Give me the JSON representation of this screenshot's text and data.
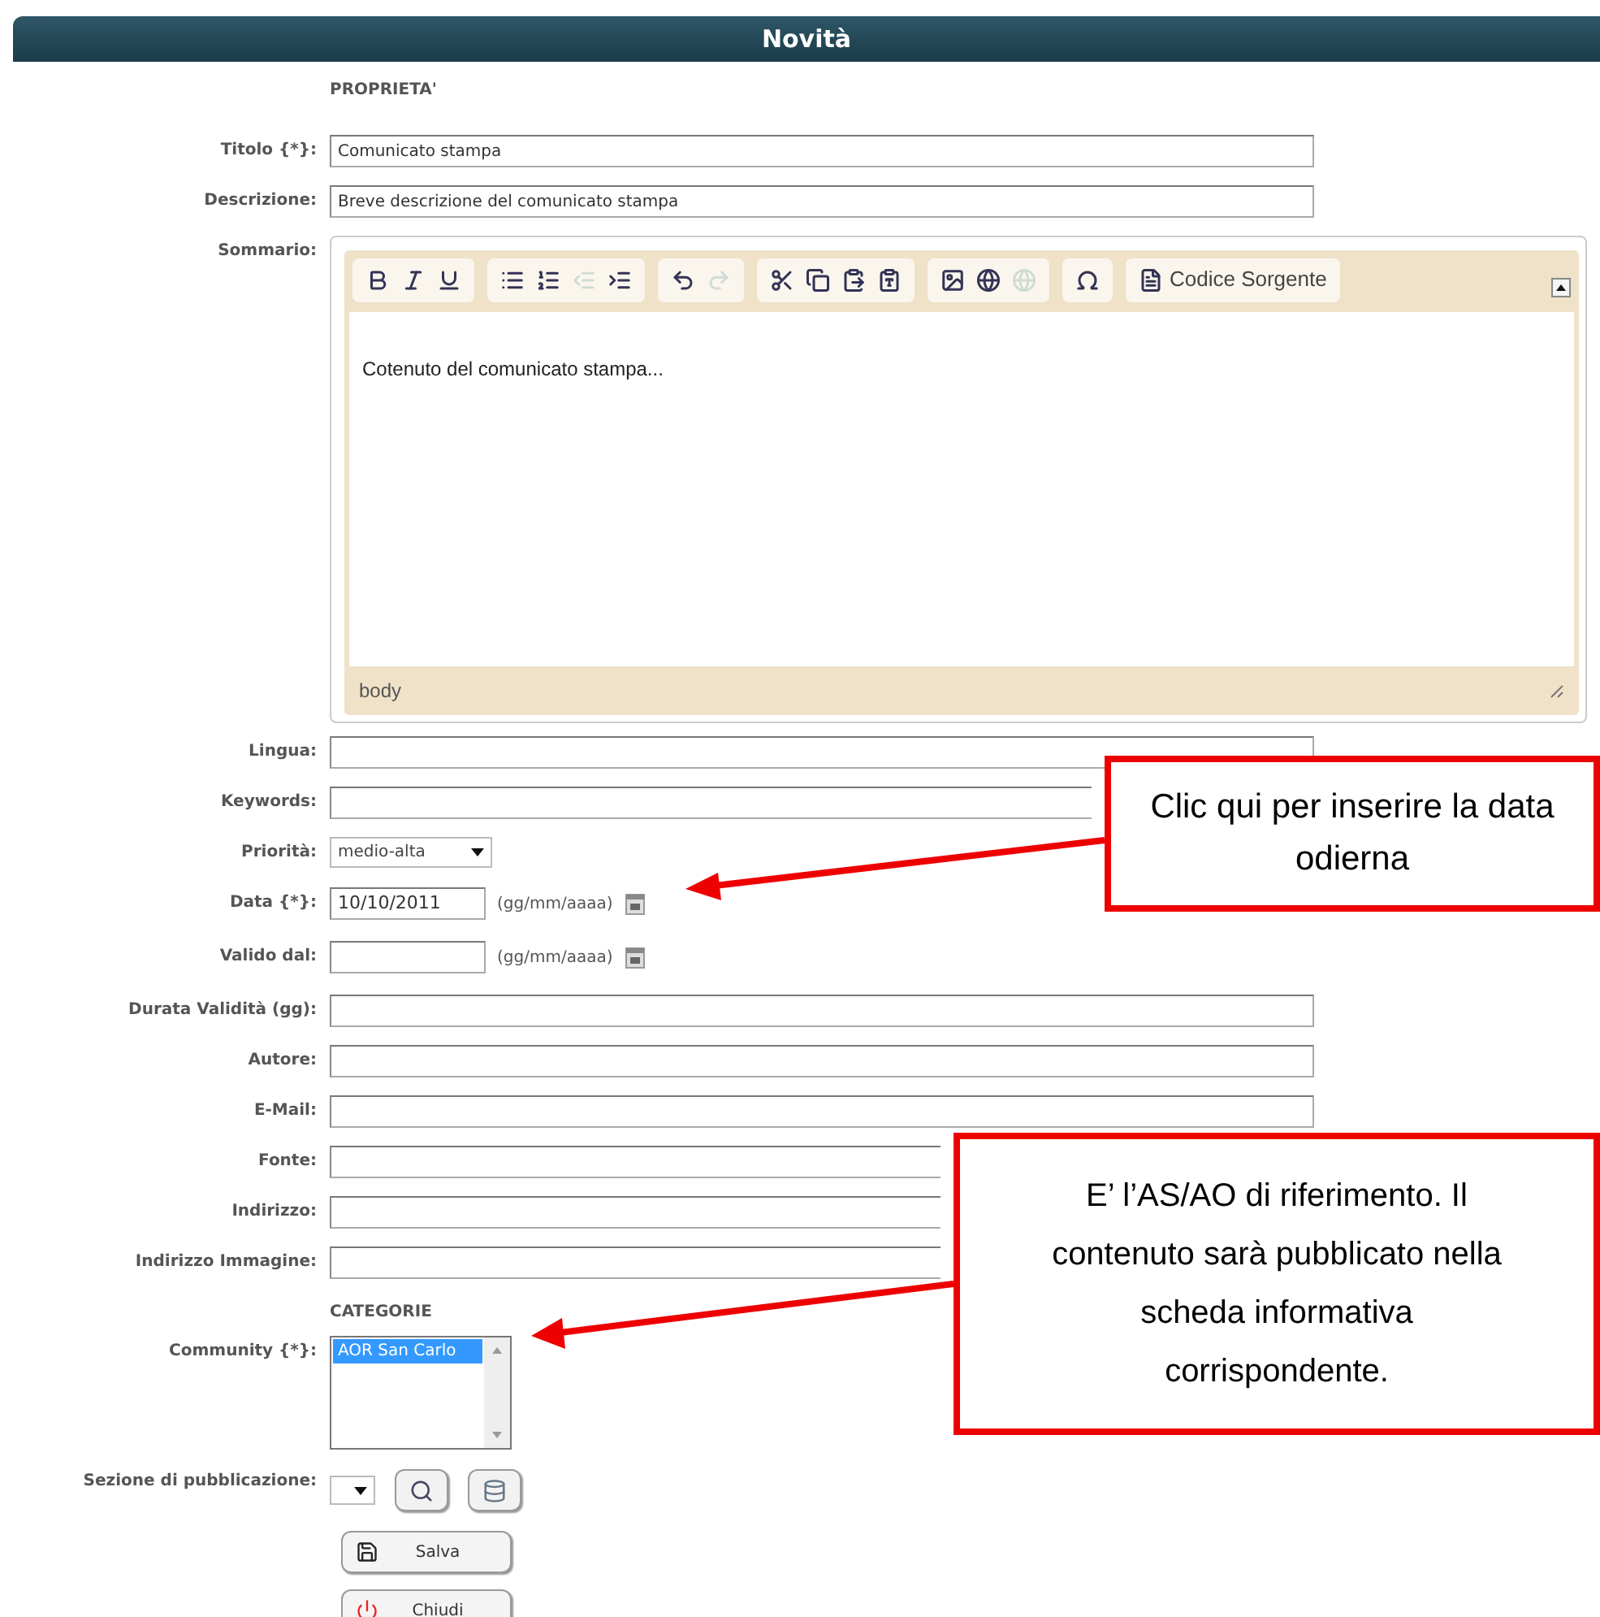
{
  "header": {
    "title": "Novità"
  },
  "section": "PROPRIETA'",
  "fields": [
    {
      "kind": "text",
      "label": "Titolo {*}:",
      "value": "Comunicato stampa"
    },
    {
      "kind": "text",
      "label": "Descrizione:",
      "value": "Breve descrizione del comunicato stampa"
    },
    {
      "kind": "editor",
      "label": "Sommario:",
      "content": "Cotenuto del comunicato stampa...",
      "status": "body",
      "toolbar": [
        [
          {
            "kind": "bold",
            "disabled": false
          },
          {
            "kind": "italic",
            "disabled": false
          },
          {
            "kind": "underline",
            "disabled": false
          }
        ],
        [
          {
            "kind": "bullets",
            "disabled": false
          },
          {
            "kind": "numbers",
            "disabled": false
          },
          {
            "kind": "outdent",
            "disabled": true
          },
          {
            "kind": "indent",
            "disabled": false
          }
        ],
        [
          {
            "kind": "undo",
            "disabled": false
          },
          {
            "kind": "redo",
            "disabled": true
          }
        ],
        [
          {
            "kind": "cut",
            "disabled": false
          },
          {
            "kind": "copy",
            "disabled": false
          },
          {
            "kind": "paste",
            "disabled": false
          },
          {
            "kind": "pasteword",
            "disabled": false
          }
        ],
        [
          {
            "kind": "image",
            "disabled": false
          },
          {
            "kind": "link",
            "disabled": false
          },
          {
            "kind": "unlink",
            "disabled": true
          }
        ],
        [
          {
            "kind": "special",
            "disabled": false
          }
        ],
        [
          {
            "kind": "source",
            "disabled": false,
            "label": "Codice Sorgente"
          }
        ]
      ]
    },
    {
      "kind": "text",
      "label": "Lingua:"
    },
    {
      "kind": "text",
      "label": "Keywords:"
    },
    {
      "kind": "select",
      "label": "Priorità:",
      "value": "medio-alta"
    },
    {
      "kind": "date",
      "label": "Data {*}:",
      "value": "10/10/2011",
      "hint": "(gg/mm/aaaa)"
    },
    {
      "kind": "date",
      "label": "Valido dal:",
      "hint": "(gg/mm/aaaa)"
    },
    {
      "kind": "text",
      "label": "Durata Validità (gg):"
    },
    {
      "kind": "text",
      "label": "Autore:"
    },
    {
      "kind": "text",
      "label": "E-Mail:"
    },
    {
      "kind": "text",
      "label": "Fonte:"
    },
    {
      "kind": "text",
      "label": "Indirizzo:"
    },
    {
      "kind": "text",
      "label": "Indirizzo Immagine:"
    },
    {
      "kind": "heading",
      "title": "CATEGORIE"
    },
    {
      "kind": "listbox",
      "label": "Community {*}:",
      "options": [
        {
          "label": "AOR San Carlo",
          "selected": true
        }
      ]
    },
    {
      "kind": "picker",
      "label": "Sezione di pubblicazione:"
    }
  ],
  "buttons": [
    {
      "kind": "save",
      "label": "Salva"
    },
    {
      "kind": "close",
      "label": "Chiudi"
    }
  ],
  "callouts": [
    {
      "text": "Clic qui per inserire la data odierna"
    },
    {
      "text": "E’ l’AS/AO di riferimento. Il contenuto sarà pubblicato nella scheda informativa corrispondente."
    }
  ]
}
